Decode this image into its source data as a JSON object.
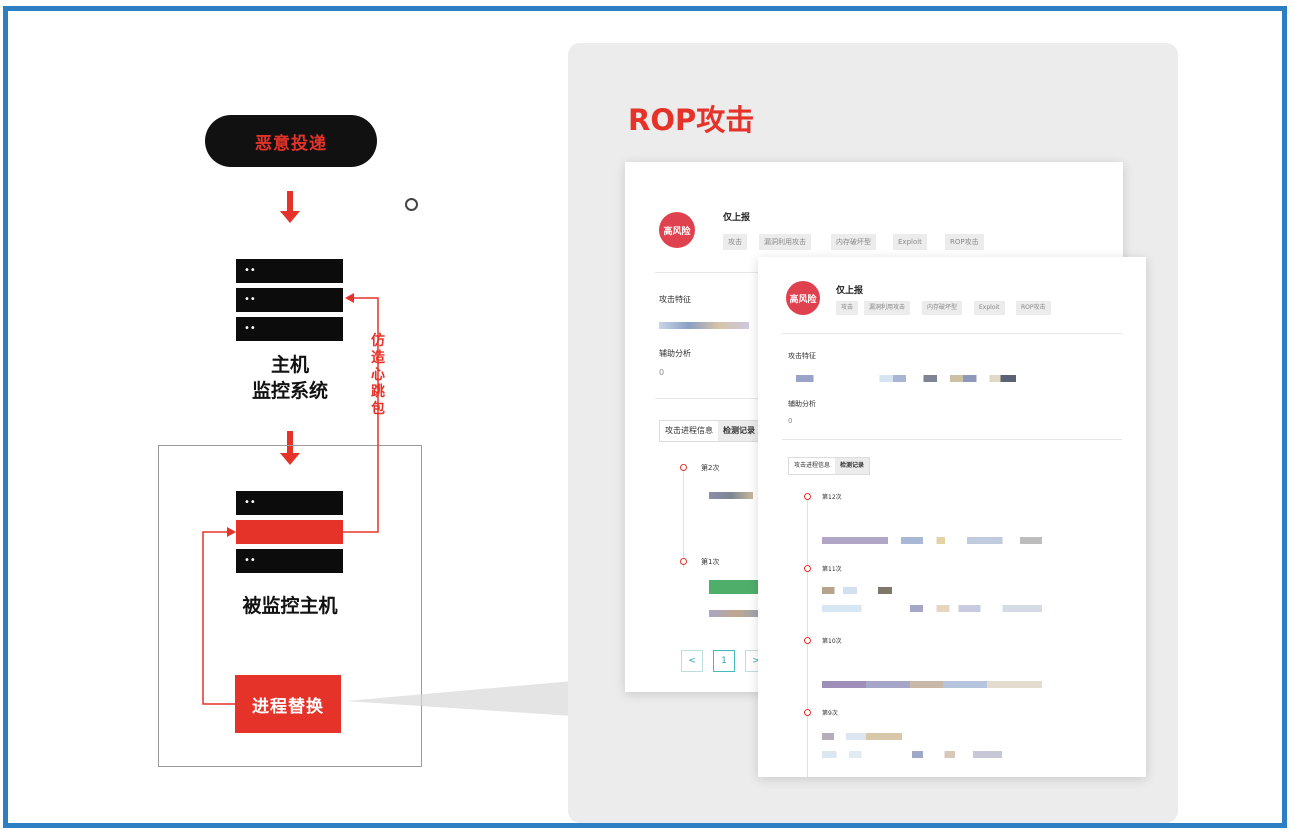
{
  "flow": {
    "top_pill": "恶意投递",
    "host_label_line1": "主机",
    "host_label_line2": "监控系统",
    "heartbeat_label": [
      "仿",
      "造",
      "心",
      "跳",
      "包"
    ],
    "monitored_label": "被监控主机",
    "process_button": "进程替换",
    "server_led": "••"
  },
  "panel": {
    "title": "ROP攻击",
    "back_card": {
      "avatar_text": "高风险",
      "user_name": "仅上报",
      "tags": [
        "攻击",
        "漏洞利用攻击",
        "内存破坏型",
        "Exploit",
        "ROP攻击"
      ],
      "feature_label": "攻击特征",
      "aux_label": "辅助分析",
      "aux_value": "0",
      "tabs": [
        "攻击进程信息",
        "检测记录"
      ],
      "timeline": [
        "第2次",
        "第1次"
      ],
      "pagination": [
        "<",
        "1",
        ">"
      ]
    },
    "front_card": {
      "avatar_text": "高风险",
      "user_name": "仅上报",
      "tags": [
        "攻击",
        "漏洞利用攻击",
        "内存破坏型",
        "Exploit",
        "ROP攻击"
      ],
      "feature_label": "攻击特征",
      "aux_label": "辅助分析",
      "aux_value": "0",
      "tabs": [
        "攻击进程信息",
        "检测记录"
      ],
      "timeline": [
        "第12次",
        "第11次",
        "第10次",
        "第9次"
      ]
    }
  },
  "colors": {
    "accent_red": "#e5332a",
    "frame_blue": "#2c7fc3",
    "avatar_red": "#e0414e"
  }
}
